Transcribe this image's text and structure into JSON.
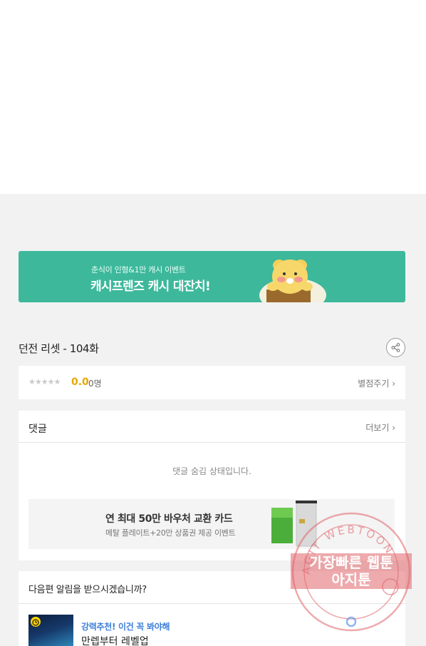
{
  "banner": {
    "subtitle": "춘식이 인형&1만 캐시 이벤트",
    "title": "캐시프렌즈 캐시 대잔치!"
  },
  "episode": {
    "title": "던전 리셋 - 104화"
  },
  "rating": {
    "stars": "★★★★★",
    "score": "0.0",
    "count": "0명",
    "rate_link": "별점주기 ›"
  },
  "comments": {
    "title": "댓글",
    "more_link": "더보기 ›",
    "hidden_message": "댓글 숨김 상태입니다."
  },
  "ad": {
    "title": "연 최대 50만 바우처 교환 카드",
    "subtitle": "메탈 플레이트+20만 상품권 제공 이벤트"
  },
  "notify": {
    "question": "다음편 알림을 받으시겠습니까?",
    "rec_tag": "강력추천! 이건 꼭 봐야해",
    "rec_title": "만렙부터 레벨업"
  },
  "watermark": {
    "ring_text": "AGIT WEBTOON",
    "line1": "가장빠른 웹툰",
    "line2": "아지툰"
  },
  "colors": {
    "banner_bg": "#3db89b",
    "score": "#e6a800",
    "rec_tag": "#3d7fd9",
    "stamp": "#e0646a"
  }
}
